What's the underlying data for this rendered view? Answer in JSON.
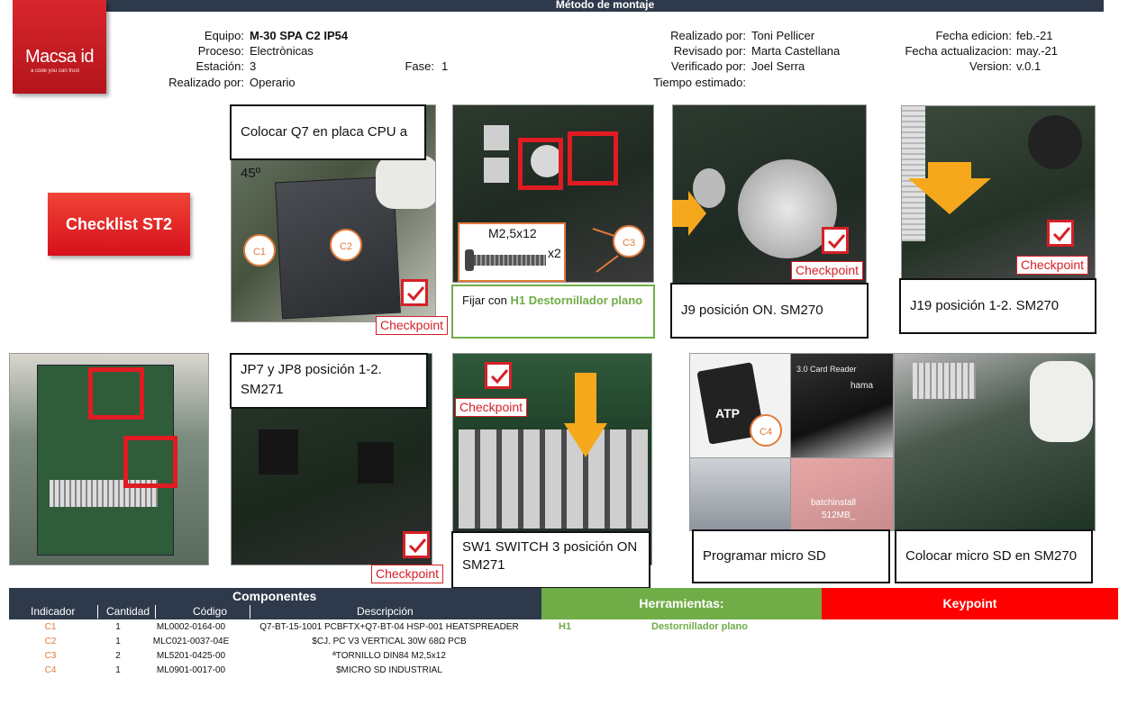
{
  "title": "Método de montaje",
  "logo": {
    "brand": "Macsa id",
    "tagline": "a code you can trust"
  },
  "header": {
    "equipo_label": "Equipo:",
    "equipo_value": "M-30 SPA C2 IP54",
    "proceso_label": "Proceso:",
    "proceso_value": "Electrònicas",
    "estacion_label": "Estación:",
    "estacion_value": "3",
    "fase_label": "Fase:",
    "fase_value": "1",
    "realizado1_label": "Realizado por:",
    "realizado1_value": "Operario",
    "realizado2_label": "Realizado por:",
    "realizado2_value": "Toni Pellicer",
    "revisado_label": "Revisado por:",
    "revisado_value": "Marta Castellana",
    "verificado_label": "Verificado por:",
    "verificado_value": "Joel Serra",
    "tiempo_label": "Tiempo estimado:",
    "tiempo_value": "",
    "fecha_edicion_label": "Fecha edicion:",
    "fecha_edicion_value": "feb.-21",
    "fecha_act_label": "Fecha actualizacion:",
    "fecha_act_value": "may.-21",
    "version_label": "Version:",
    "version_value": "v.0.1"
  },
  "checklist_button": "Checklist ST2",
  "checkpoint_label": "Checkpoint",
  "steps": {
    "s1": "Colocar Q7 en placa CPU a 45º",
    "s2_prefix": "Fijar con ",
    "s2_tool": "H1 Destornillador plano",
    "s2_screw": "M2,5x12",
    "s2_qty": "x2",
    "s3": "J9 posición ON. SM270",
    "s4": "J19 posición 1-2. SM270",
    "s5": "JP7 y JP8 posición 1-2. SM271",
    "s6": "SW1 SWITCH 3 posición ON SM271",
    "s7": "Programar micro SD",
    "s8": "Colocar micro SD en SM270"
  },
  "markers": {
    "c1": "C1",
    "c2": "C2",
    "c3": "C3",
    "c4": "C4"
  },
  "photo_text": {
    "sd_brand": "ATP",
    "card_reader": "3.0 Card Reader",
    "hama": "hama",
    "batch": "batchinstall",
    "size": "512MB_"
  },
  "components": {
    "title": "Componentes",
    "headers": [
      "Indicador",
      "Cantidad",
      "Código",
      "Descripción"
    ],
    "rows": [
      {
        "ind": "C1",
        "qty": "1",
        "code": "ML0002-0164-00",
        "desc": "Q7-BT-15-1001 PCBFTX+Q7-BT-04 HSP-001 HEATSPREADER"
      },
      {
        "ind": "C2",
        "qty": "1",
        "code": "MLC021-0037-04E",
        "desc": "$CJ. PC V3 VERTICAL 30W 68Ω PCB"
      },
      {
        "ind": "C3",
        "qty": "2",
        "code": "ML5201-0425-00",
        "desc": "ªTORNILLO DIN84 M2,5x12"
      },
      {
        "ind": "C4",
        "qty": "1",
        "code": "ML0901-0017-00",
        "desc": "$MICRO SD INDUSTRIAL"
      }
    ]
  },
  "tools": {
    "title": "Herramientas:",
    "id": "H1",
    "name": "Destornillador plano"
  },
  "keypoint": {
    "title": "Keypoint"
  },
  "colors": {
    "header_bar": "#2e3a4b",
    "brand_red": "#d6101a",
    "tools_green": "#70ad47",
    "keypoint_red": "#ff0000",
    "marker_orange": "#e07b39"
  }
}
